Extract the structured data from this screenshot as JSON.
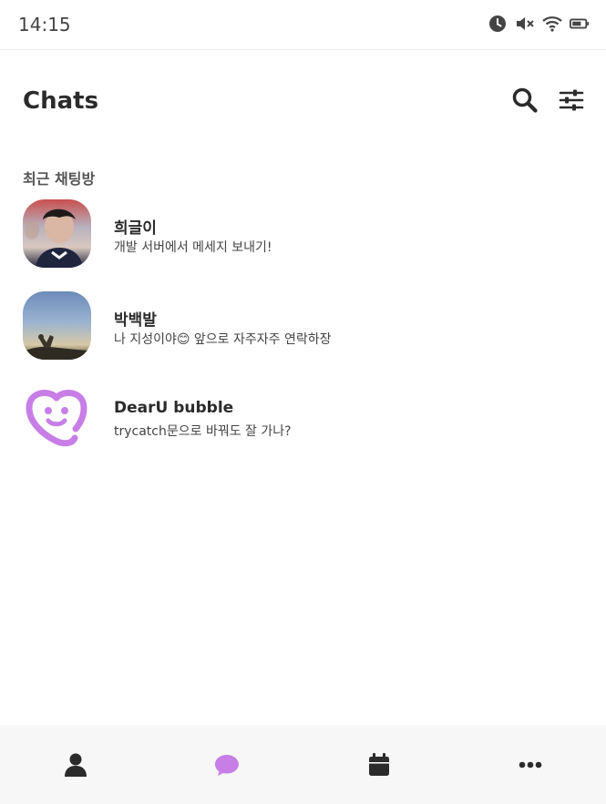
{
  "status_bar": {
    "time": "14:15",
    "icons": [
      "alarm-icon",
      "mute-icon",
      "wifi-icon",
      "battery-icon"
    ]
  },
  "header": {
    "title": "Chats",
    "actions": [
      "search-icon",
      "filter-icon"
    ]
  },
  "section": {
    "title": "최근 채팅방"
  },
  "chats": [
    {
      "name": "희글이",
      "preview": "개발 서버에서 메세지 보내기!"
    },
    {
      "name": "박백발",
      "preview": "나 지성이야😊 앞으로 자주자주 연락하장"
    },
    {
      "name": "DearU bubble",
      "preview": "trycatch문으로 바꿔도 잘 가나?"
    }
  ],
  "bottom_nav": {
    "items": [
      "person-icon",
      "chat-bubble-icon",
      "calendar-icon",
      "more-icon"
    ],
    "active": "chat-bubble-icon"
  },
  "colors": {
    "accent": "#c77ee6",
    "text": "#2b2b2b",
    "nav_bg": "#f7f7f7"
  }
}
